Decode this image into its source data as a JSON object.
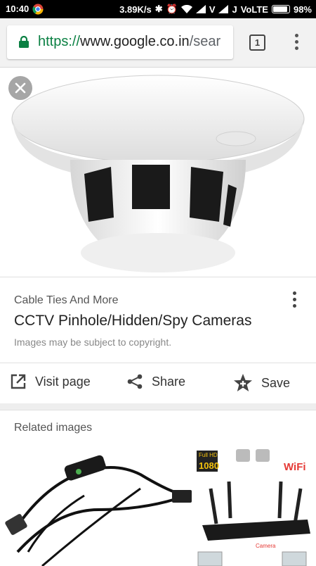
{
  "status_bar": {
    "time": "10:40",
    "speed": "3.89K/s",
    "carrier1": "V",
    "carrier2": "J",
    "network": "VoLTE",
    "battery": "98%"
  },
  "browser": {
    "url_scheme": "https://",
    "url_host": "www.google.co.in",
    "url_rest": "/sear",
    "tab_count": "1"
  },
  "result": {
    "source": "Cable Ties And More",
    "title": "CCTV Pinhole/Hidden/Spy Cameras",
    "copyright": "Images may be subject to copyright."
  },
  "actions": {
    "visit": "Visit page",
    "share": "Share",
    "save": "Save"
  },
  "related": {
    "heading": "Related images",
    "thumb2_badge": "Full HD",
    "thumb2_res": "1080",
    "thumb2_wifi": "WiFi",
    "thumb2_camera": "Camera"
  },
  "colors": {
    "secure_green": "#0b8043",
    "wifi_red": "#e53935"
  }
}
